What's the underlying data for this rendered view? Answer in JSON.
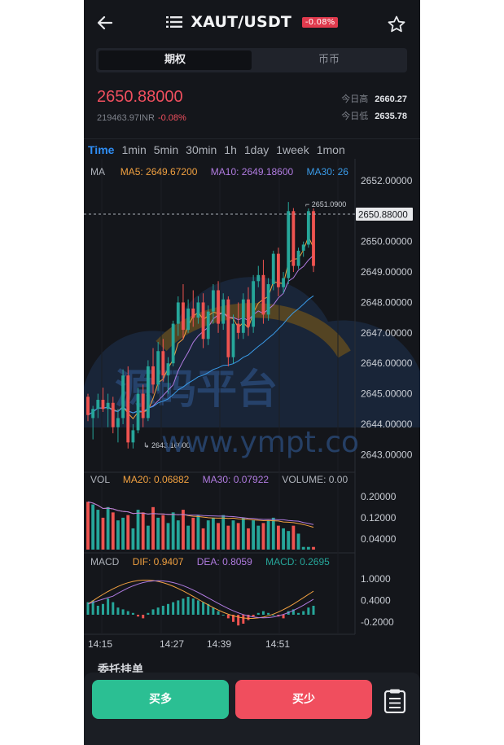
{
  "header": {
    "symbol": "XAUT/USDT",
    "change_badge": "-0.08%"
  },
  "segment": [
    "期权",
    "币币"
  ],
  "price": {
    "last": "2650.88000",
    "converted": "219463.97INR",
    "change": "-0.08%",
    "high_label": "今日高",
    "high_value": "2660.27",
    "low_label": "今日低",
    "low_value": "2635.78"
  },
  "timeframes": [
    "Time",
    "1min",
    "5min",
    "30min",
    "1h",
    "1day",
    "1week",
    "1mon"
  ],
  "ma_legend": {
    "label": "MA",
    "ma5": "MA5: 2649.67200",
    "ma10": "MA10: 2649.18600",
    "ma30": "MA30: 26"
  },
  "vol_legend": {
    "label": "VOL",
    "ma20": "MA20: 0.06882",
    "ma30": "MA30: 0.07922",
    "volume": "VOLUME: 0.00"
  },
  "macd_legend": {
    "label": "MACD",
    "dif": "DIF: 0.9407",
    "dea": "DEA: 0.8059",
    "macd": "MACD: 0.2695"
  },
  "price_axis": [
    "2652.00000",
    "2651.00000",
    "2650.00000",
    "2649.00000",
    "2648.00000",
    "2647.00000",
    "2646.00000",
    "2645.00000",
    "2644.00000",
    "2643.00000"
  ],
  "vol_axis": [
    "0.20000",
    "0.12000",
    "0.04000"
  ],
  "macd_axis": [
    "1.0000",
    "0.4000",
    "-0.2000"
  ],
  "time_axis": [
    "14:15",
    "14:27",
    "14:39",
    "14:51"
  ],
  "chart_labels": {
    "current_price_tag": "2650.88000",
    "max_label": "2651.0900",
    "min_label": "2643.16000"
  },
  "watermark": "源码平台 www.ympt.co",
  "section_peek": "委托挂单",
  "actions": {
    "buy": "买多",
    "sell": "买少"
  },
  "colors": {
    "up": "#26a69a",
    "down": "#ef5350",
    "ma5": "#f0a040",
    "ma10": "#b07be0",
    "ma30": "#3a9be8",
    "accent": "#2f8ef5",
    "buy_button": "#2bbf93",
    "sell_button": "#f04e5e"
  },
  "chart_data": {
    "type": "candlestick",
    "y_range": [
      2642.5,
      2652.4
    ],
    "candles": [
      [
        2644.9,
        2645.0,
        2644.1,
        2644.3
      ],
      [
        2644.2,
        2644.6,
        2643.5,
        2644.5
      ],
      [
        2644.5,
        2645.0,
        2644.2,
        2644.8
      ],
      [
        2644.8,
        2645.2,
        2644.4,
        2644.5
      ],
      [
        2644.5,
        2645.0,
        2643.9,
        2644.7
      ],
      [
        2644.7,
        2644.9,
        2643.7,
        2643.9
      ],
      [
        2643.9,
        2644.5,
        2643.4,
        2644.2
      ],
      [
        2644.2,
        2645.8,
        2644.0,
        2645.6
      ],
      [
        2645.6,
        2645.9,
        2643.2,
        2643.4
      ],
      [
        2643.4,
        2644.0,
        2643.2,
        2643.8
      ],
      [
        2643.8,
        2645.2,
        2643.7,
        2645.0
      ],
      [
        2645.0,
        2645.3,
        2643.9,
        2644.2
      ],
      [
        2644.2,
        2646.1,
        2644.1,
        2645.9
      ],
      [
        2645.9,
        2646.5,
        2645.0,
        2645.3
      ],
      [
        2645.3,
        2646.7,
        2645.1,
        2646.4
      ],
      [
        2646.4,
        2646.8,
        2645.4,
        2645.6
      ],
      [
        2645.6,
        2646.2,
        2645.0,
        2646.0
      ],
      [
        2646.0,
        2647.4,
        2645.9,
        2647.3
      ],
      [
        2647.3,
        2648.2,
        2646.9,
        2648.0
      ],
      [
        2648.0,
        2648.6,
        2646.8,
        2647.1
      ],
      [
        2647.1,
        2648.1,
        2647.0,
        2647.8
      ],
      [
        2647.8,
        2648.4,
        2647.2,
        2647.5
      ],
      [
        2647.5,
        2648.2,
        2647.3,
        2648.0
      ],
      [
        2648.0,
        2648.3,
        2646.5,
        2646.8
      ],
      [
        2646.8,
        2647.9,
        2646.6,
        2647.7
      ],
      [
        2647.7,
        2648.6,
        2647.3,
        2648.4
      ],
      [
        2648.4,
        2648.7,
        2647.0,
        2647.3
      ],
      [
        2647.3,
        2648.3,
        2647.1,
        2648.1
      ],
      [
        2648.1,
        2648.2,
        2645.9,
        2646.2
      ],
      [
        2646.2,
        2647.6,
        2646.0,
        2647.3
      ],
      [
        2647.3,
        2648.0,
        2646.8,
        2647.0
      ],
      [
        2647.0,
        2648.3,
        2646.8,
        2648.1
      ],
      [
        2648.1,
        2648.5,
        2646.9,
        2647.2
      ],
      [
        2647.2,
        2648.9,
        2647.0,
        2648.7
      ],
      [
        2648.7,
        2649.2,
        2648.5,
        2648.9
      ],
      [
        2648.9,
        2649.4,
        2647.3,
        2647.6
      ],
      [
        2647.6,
        2648.8,
        2647.4,
        2648.6
      ],
      [
        2648.6,
        2649.7,
        2648.4,
        2649.6
      ],
      [
        2649.6,
        2649.8,
        2648.2,
        2648.5
      ],
      [
        2648.5,
        2649.0,
        2648.3,
        2648.8
      ],
      [
        2648.8,
        2651.3,
        2648.6,
        2651.0
      ],
      [
        2651.0,
        2651.1,
        2649.0,
        2649.2
      ],
      [
        2649.2,
        2649.8,
        2649.1,
        2649.7
      ],
      [
        2649.7,
        2650.0,
        2649.5,
        2649.9
      ],
      [
        2649.9,
        2651.09,
        2649.8,
        2651.0
      ],
      [
        2651.0,
        2651.09,
        2649.0,
        2649.2
      ]
    ],
    "volume": [
      0.18,
      0.17,
      0.15,
      0.12,
      0.16,
      0.14,
      0.11,
      0.12,
      0.13,
      0.08,
      0.15,
      0.14,
      0.09,
      0.16,
      0.12,
      0.13,
      0.1,
      0.14,
      0.11,
      0.15,
      0.09,
      0.12,
      0.13,
      0.08,
      0.11,
      0.12,
      0.1,
      0.13,
      0.09,
      0.11,
      0.1,
      0.12,
      0.08,
      0.11,
      0.09,
      0.1,
      0.11,
      0.12,
      0.09,
      0.08,
      0.07,
      0.09,
      0.06,
      0.01,
      0.01,
      0.01
    ],
    "macd_hist": [
      0.35,
      0.4,
      0.25,
      0.3,
      0.45,
      0.35,
      0.2,
      0.15,
      0.1,
      0.05,
      -0.05,
      -0.1,
      0.05,
      0.15,
      0.2,
      0.25,
      0.3,
      0.35,
      0.4,
      0.45,
      0.5,
      0.45,
      0.4,
      0.35,
      0.3,
      0.2,
      0.1,
      0.0,
      -0.1,
      -0.2,
      -0.3,
      -0.25,
      -0.15,
      -0.05,
      0.05,
      0.1,
      0.05,
      0.0,
      -0.05,
      -0.1,
      0.1,
      0.15,
      0.05,
      0.1,
      0.2,
      0.25
    ]
  }
}
